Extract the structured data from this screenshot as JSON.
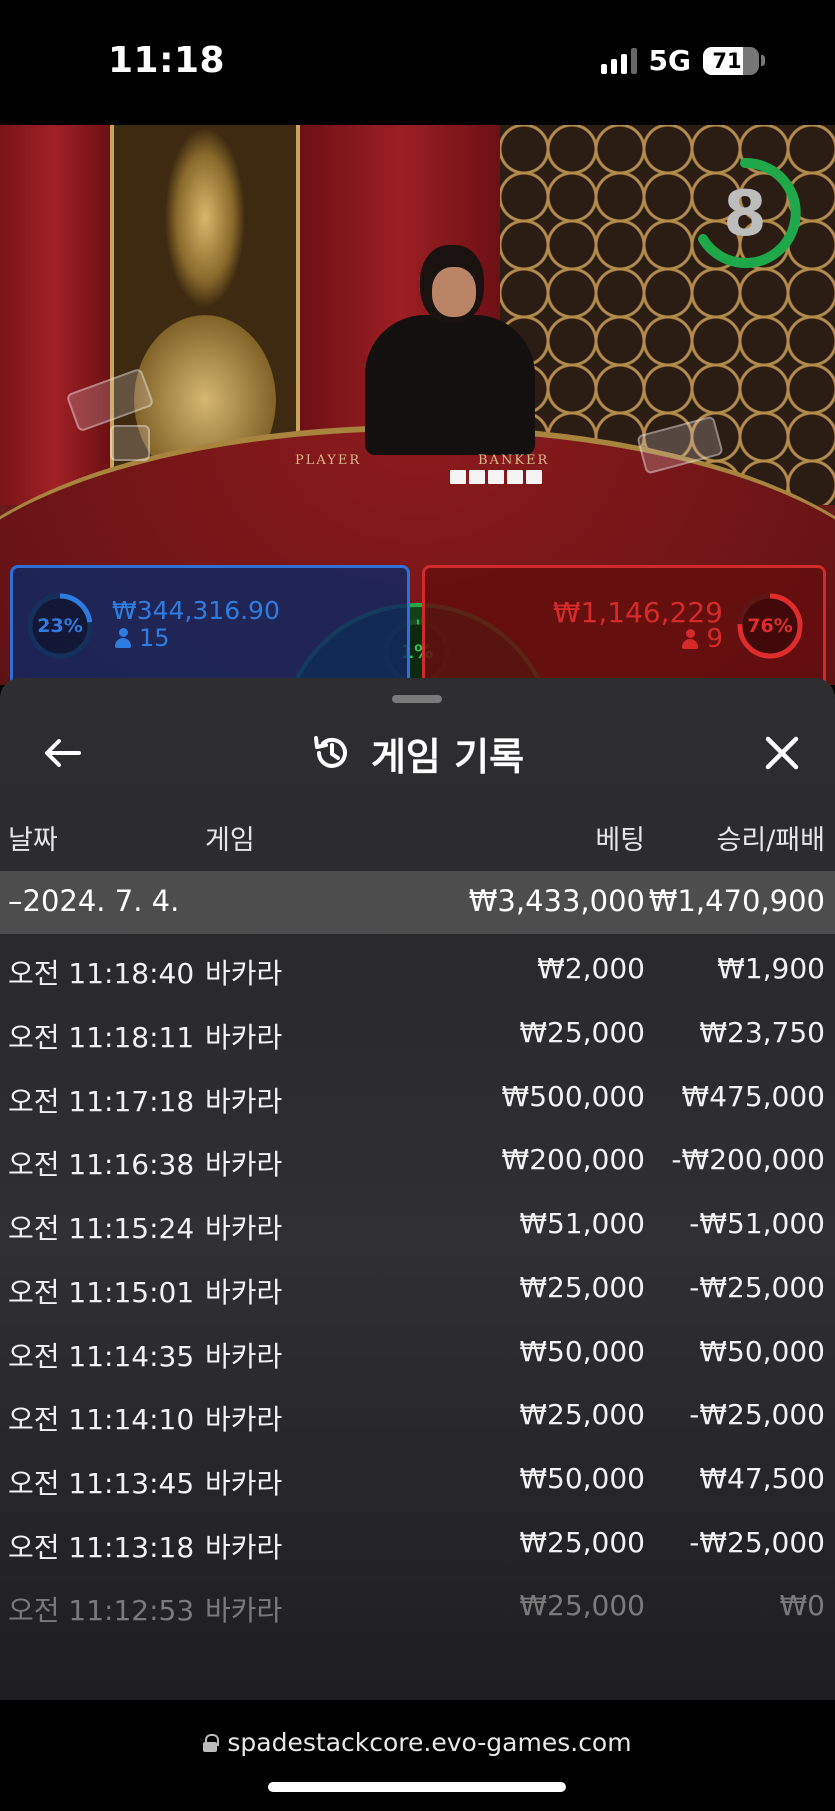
{
  "status_bar": {
    "time": "11:18",
    "network": "5G",
    "battery": "71",
    "battery_level": 0.71
  },
  "live_game": {
    "countdown": "8",
    "table_labels": {
      "player": "PLAYER",
      "banker": "BANKER"
    },
    "player": {
      "percent": "23%",
      "percent_value": 23,
      "amount": "₩344,316.90",
      "bettors": "15",
      "color": "#2f6fd6"
    },
    "tie": {
      "percent": "1%",
      "percent_value": 1,
      "color": "#28a745"
    },
    "banker": {
      "percent": "76%",
      "percent_value": 76,
      "amount": "₩1,146,229",
      "bettors": "9",
      "color": "#d02a2a"
    }
  },
  "history": {
    "title": "게임 기록",
    "columns": {
      "date": "날짜",
      "game": "게임",
      "bet": "베팅",
      "result": "승리/패배"
    },
    "day": {
      "date": "–2024. 7. 4.",
      "total_bet": "₩3,433,000",
      "total_result": "₩1,470,900"
    },
    "rows": [
      {
        "time": "오전 11:18:40",
        "game": "바카라",
        "bet": "₩2,000",
        "result": "₩1,900"
      },
      {
        "time": "오전 11:18:11",
        "game": "바카라",
        "bet": "₩25,000",
        "result": "₩23,750"
      },
      {
        "time": "오전 11:17:18",
        "game": "바카라",
        "bet": "₩500,000",
        "result": "₩475,000"
      },
      {
        "time": "오전 11:16:38",
        "game": "바카라",
        "bet": "₩200,000",
        "result": "-₩200,000"
      },
      {
        "time": "오전 11:15:24",
        "game": "바카라",
        "bet": "₩51,000",
        "result": "-₩51,000"
      },
      {
        "time": "오전 11:15:01",
        "game": "바카라",
        "bet": "₩25,000",
        "result": "-₩25,000"
      },
      {
        "time": "오전 11:14:35",
        "game": "바카라",
        "bet": "₩50,000",
        "result": "₩50,000"
      },
      {
        "time": "오전 11:14:10",
        "game": "바카라",
        "bet": "₩25,000",
        "result": "-₩25,000"
      },
      {
        "time": "오전 11:13:45",
        "game": "바카라",
        "bet": "₩50,000",
        "result": "₩47,500"
      },
      {
        "time": "오전 11:13:18",
        "game": "바카라",
        "bet": "₩25,000",
        "result": "-₩25,000"
      },
      {
        "time": "오전 11:12:53",
        "game": "바카라",
        "bet": "₩25,000",
        "result": "₩0"
      }
    ]
  },
  "browser": {
    "url": "spadestackcore.evo-games.com"
  },
  "icons": {
    "back": "arrow-left-icon",
    "history": "history-clock-icon",
    "close": "close-icon",
    "lock": "lock-icon"
  }
}
